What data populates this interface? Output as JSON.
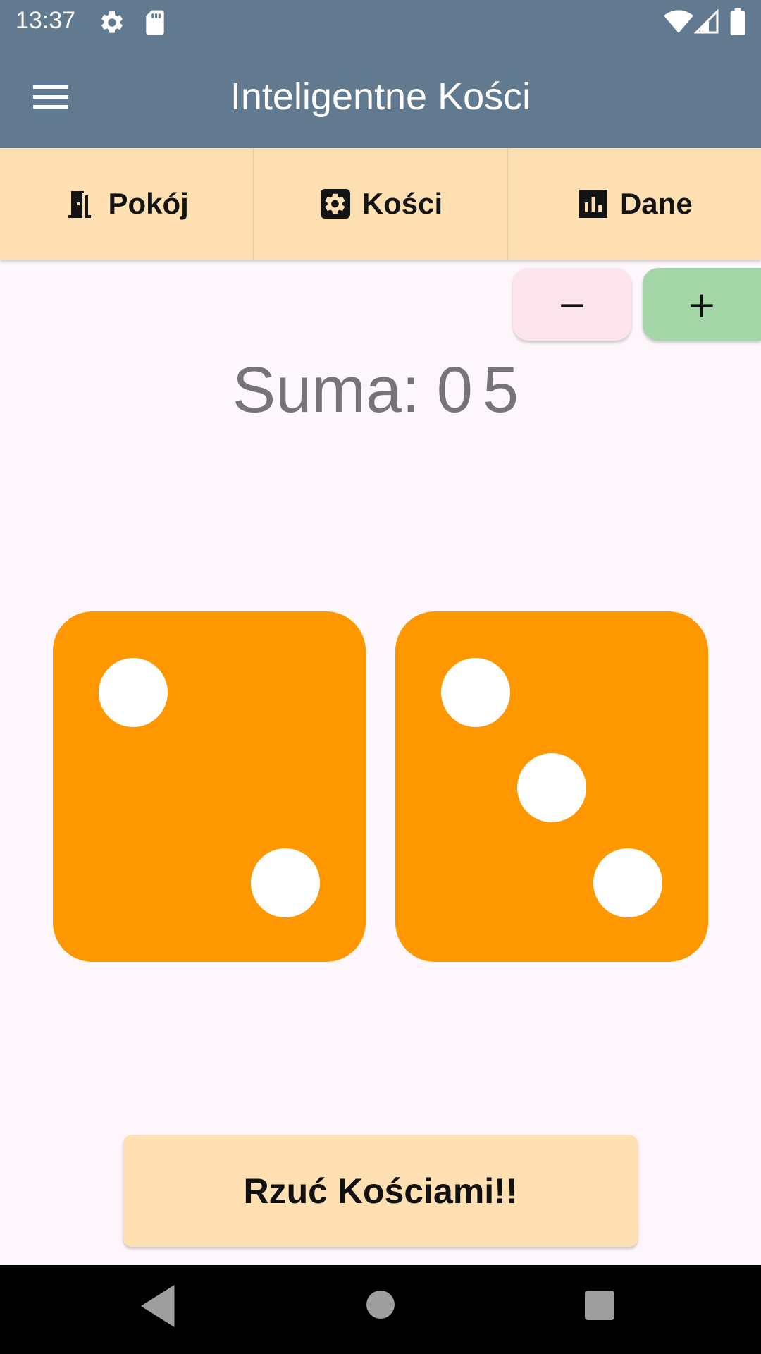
{
  "status_bar": {
    "time": "13:37",
    "icons": [
      "gear-icon",
      "sd-card-icon",
      "wifi-icon",
      "signal-icon",
      "battery-icon"
    ]
  },
  "app_bar": {
    "title": "Inteligentne Kości",
    "menu_icon": "menu-icon"
  },
  "tabs": [
    {
      "label": "Pokój",
      "icon": "door-icon"
    },
    {
      "label": "Kości",
      "icon": "settings-icon"
    },
    {
      "label": "Dane",
      "icon": "bar-chart-icon"
    }
  ],
  "stepper": {
    "minus_label": "−",
    "plus_label": "+"
  },
  "sum": {
    "label": "Suma:",
    "value": "05"
  },
  "dice": [
    {
      "value": 2
    },
    {
      "value": 3
    }
  ],
  "roll_button": {
    "label": "Rzuć Kościami!!"
  },
  "colors": {
    "app_bar": "#627A8F",
    "tab_bar": "#FFE0B3",
    "die": "#FF9800",
    "pip": "#FFFFFF",
    "minus_button": "#FCE4EC",
    "plus_button": "#A5D6A7",
    "background": "#FDF7FC"
  },
  "nav_bar": {
    "icons": [
      "back-icon",
      "home-icon",
      "recents-icon"
    ]
  }
}
